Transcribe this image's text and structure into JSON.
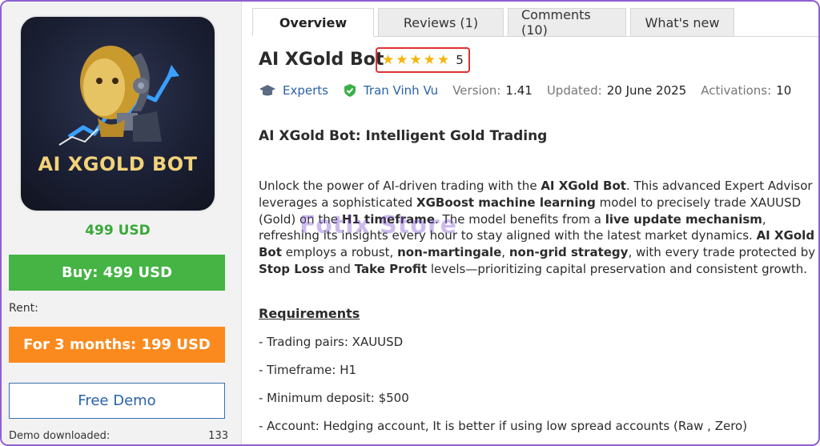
{
  "product": {
    "logo_text": "AI XGOLD BOT",
    "price": "499 USD",
    "buy_label": "Buy: 499 USD",
    "rent_label": "Rent:",
    "rent_button": "For 3 months: 199 USD",
    "demo_button": "Free Demo",
    "demo_downloaded_label": "Demo downloaded:",
    "demo_downloaded_count": "133"
  },
  "tabs": [
    {
      "label": "Overview",
      "active": true
    },
    {
      "label": "Reviews (1)"
    },
    {
      "label": "Comments (10)"
    },
    {
      "label": "What's new"
    }
  ],
  "header": {
    "title": "AI XGold Bot",
    "rating": "5",
    "stars": 5
  },
  "meta": {
    "category": "Experts",
    "author": "Tran Vinh Vu",
    "version_label": "Version:",
    "version": "1.41",
    "updated_label": "Updated:",
    "updated": "20 June 2025",
    "activations_label": "Activations:",
    "activations": "10"
  },
  "content": {
    "subheading": "AI XGold Bot: Intelligent Gold Trading",
    "desc": {
      "p1": "Unlock the power of AI-driven trading with the ",
      "b1": "AI XGold Bot",
      "p2": ". This advanced Expert Advisor leverages a sophisticated ",
      "b2": "XGBoost machine learning",
      "p3": " model to precisely trade XAUUSD (Gold) on the ",
      "b3": "H1 timeframe",
      "p4": ". The model benefits from a ",
      "b4": "live update mechanism",
      "p5": ", refreshing its insights every hour to stay aligned with the latest market dynamics. ",
      "b5": "AI XGold Bot",
      "p6": " employs a robust, ",
      "b6": "non-martingale",
      "p7": ", ",
      "b7": "non-grid strategy",
      "p8": ", with every trade protected by ",
      "b8": "Stop Loss",
      "p9": " and ",
      "b9": "Take Profit",
      "p10": " levels—prioritizing capital preservation and consistent growth."
    },
    "requirements_heading": "Requirements",
    "requirements": [
      "- Trading pairs: XAUUSD",
      "- Timeframe:  H1",
      "- Minimum deposit: $500",
      "- Account:  Hedging account, It is better if using low spread accounts (Raw , Zero)"
    ]
  },
  "watermark": "Fotix Store",
  "colors": {
    "buy": "#45b445",
    "rent": "#fb8a1e",
    "link": "#2a62a8",
    "star": "#f5b50a",
    "rating_border": "#e03030"
  }
}
